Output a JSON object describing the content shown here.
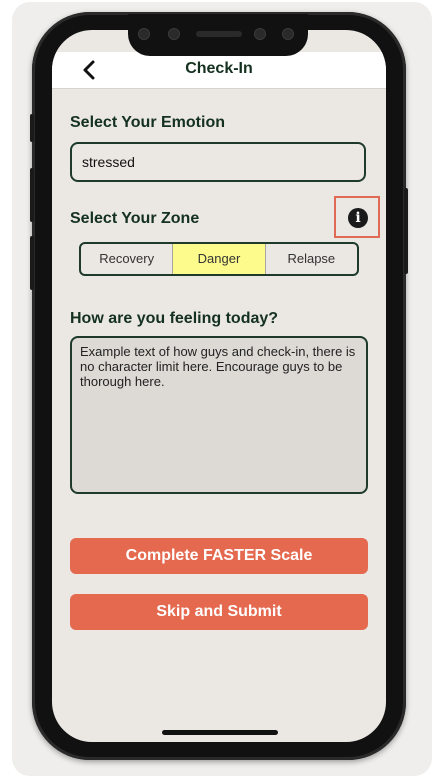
{
  "header": {
    "title": "Check-In",
    "back_icon": "chevron-left-icon"
  },
  "emotion": {
    "label": "Select Your Emotion",
    "value": "stressed"
  },
  "zone": {
    "label": "Select Your Zone",
    "info_icon": "info-icon",
    "options": [
      "Recovery",
      "Danger",
      "Relapse"
    ],
    "selected": "Danger",
    "selected_color": "#fdfb8c"
  },
  "feelings": {
    "label": "How are you feeling today?",
    "placeholder": "Example text of how guys and check-in, there is no character limit here. Encourage guys to be thorough here."
  },
  "actions": {
    "faster_label": "Complete FASTER Scale",
    "submit_label": "Skip and Submit",
    "button_color": "#e4694f"
  },
  "highlight_color": "#e06a55"
}
